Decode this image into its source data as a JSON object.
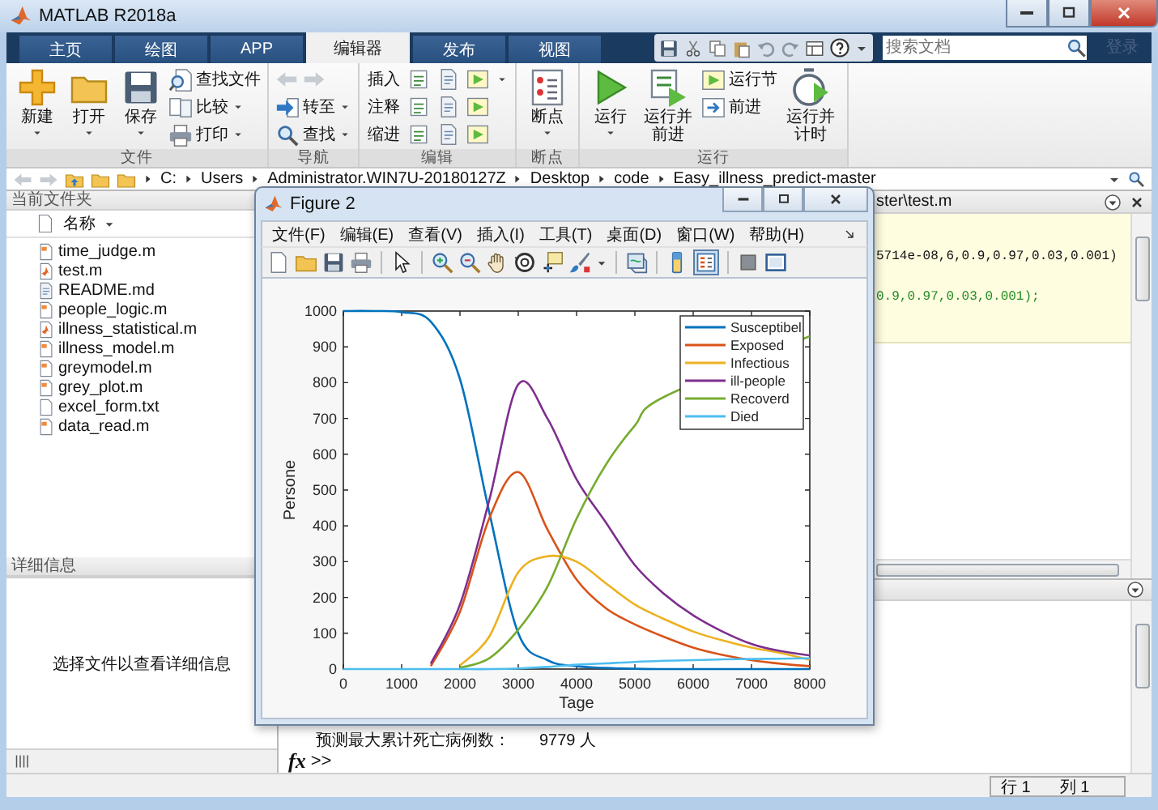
{
  "window": {
    "title": "MATLAB R2018a"
  },
  "tabs": [
    {
      "label": "主页",
      "selected": false
    },
    {
      "label": "绘图",
      "selected": false
    },
    {
      "label": "APP",
      "selected": false
    },
    {
      "label": "编辑器",
      "selected": true
    },
    {
      "label": "发布",
      "selected": false
    },
    {
      "label": "视图",
      "selected": false
    }
  ],
  "search": {
    "placeholder": "搜索文档"
  },
  "sign_in": "登录",
  "toolstrip": [
    {
      "label": "文件",
      "items": [
        {
          "kind": "large",
          "label": "新建",
          "caret": true
        },
        {
          "kind": "large",
          "label": "打开",
          "caret": true
        },
        {
          "kind": "large",
          "label": "保存",
          "caret": true
        },
        {
          "kind": "stack",
          "items": [
            {
              "kind": "button",
              "label": "查找文件",
              "caret": false
            },
            {
              "kind": "button",
              "label": "比较",
              "caret": true
            },
            {
              "kind": "button",
              "label": "打印",
              "caret": true
            }
          ]
        }
      ]
    },
    {
      "label": "导航",
      "items": [
        {
          "kind": "stack",
          "items": [
            {
              "kind": "arrows"
            },
            {
              "kind": "button",
              "label": "转至",
              "caret": true
            },
            {
              "kind": "button",
              "label": "查找",
              "caret": true
            }
          ]
        }
      ]
    },
    {
      "label": "编辑",
      "items": [
        {
          "kind": "icon-rows",
          "rows": [
            {
              "label": "插入",
              "caret": true
            },
            {
              "label": "注释",
              "caret": false
            },
            {
              "label": "缩进",
              "caret": false
            }
          ]
        }
      ]
    },
    {
      "label": "断点",
      "items": [
        {
          "kind": "large",
          "label": "断点",
          "caret": true
        }
      ]
    },
    {
      "label": "运行",
      "items": [
        {
          "kind": "large",
          "label": "运行",
          "caret": true
        },
        {
          "kind": "large",
          "label": "运行并前进",
          "caret": false
        },
        {
          "kind": "stack",
          "items": [
            {
              "kind": "button",
              "label": "运行节",
              "caret": false
            },
            {
              "kind": "button",
              "label": "前进",
              "caret": false
            }
          ]
        },
        {
          "kind": "large",
          "label": "运行并计时",
          "caret": false
        }
      ]
    }
  ],
  "address": {
    "path": [
      "C:",
      "Users",
      "Administrator.WIN7U-20180127Z",
      "Desktop",
      "code",
      "Easy_illness_predict-master"
    ]
  },
  "current_folder": {
    "title": "当前文件夹",
    "column": "名称",
    "files": [
      {
        "name": "time_judge.m",
        "kind": "function"
      },
      {
        "name": "test.m",
        "kind": "script"
      },
      {
        "name": "README.md",
        "kind": "document"
      },
      {
        "name": "people_logic.m",
        "kind": "function"
      },
      {
        "name": "illness_statistical.m",
        "kind": "script"
      },
      {
        "name": "illness_model.m",
        "kind": "function"
      },
      {
        "name": "greymodel.m",
        "kind": "function"
      },
      {
        "name": "grey_plot.m",
        "kind": "function"
      },
      {
        "name": "excel_form.txt",
        "kind": "text"
      },
      {
        "name": "data_read.m",
        "kind": "function"
      }
    ]
  },
  "details": {
    "title": "详细信息",
    "message": "选择文件以查看详细信息"
  },
  "editor": {
    "path": "ster\\test.m",
    "lines": [
      {
        "text": "5714e-08,6,0.9,0.97,0.03,0.001)",
        "kind": "code"
      },
      {
        "text": "0.9,0.97,0.03,0.001);",
        "kind": "comment"
      }
    ]
  },
  "command_window": {
    "lines": [
      {
        "label": "预测最大累计死亡病例数：",
        "value": "9779 人"
      }
    ],
    "fx": "fx",
    "prompt": ">>"
  },
  "status_bar": {
    "row": "行 1",
    "column": "列 1"
  },
  "figure": {
    "title": "Figure 2",
    "menu": [
      "文件(F)",
      "编辑(E)",
      "查看(V)",
      "插入(I)",
      "工具(T)",
      "桌面(D)",
      "窗口(W)",
      "帮助(H)"
    ],
    "chart_data": {
      "type": "line",
      "xlabel": "Tage",
      "ylabel": "Persone",
      "x": [
        0,
        500,
        1000,
        1500,
        2000,
        2500,
        3000,
        3500,
        4000,
        4500,
        5000,
        5500,
        6000,
        6500,
        7000,
        7500,
        8000
      ],
      "xlim": [
        0,
        8000
      ],
      "ylim": [
        0,
        1000
      ],
      "legend": true,
      "xticks": [
        0,
        1000,
        2000,
        3000,
        4000,
        5000,
        6000,
        7000,
        8000
      ],
      "yticks": [
        0,
        100,
        200,
        300,
        400,
        500,
        600,
        700,
        800,
        900,
        1000
      ],
      "series": [
        {
          "name": "Susceptibel",
          "color": "#0072bd",
          "values": [
            1000,
            1000,
            997,
            970,
            810,
            440,
            100,
            25,
            8,
            3,
            1,
            0,
            0,
            0,
            0,
            0,
            0
          ]
        },
        {
          "name": "Exposed",
          "color": "#d95319",
          "values": [
            null,
            null,
            null,
            8,
            160,
            420,
            550,
            390,
            250,
            170,
            125,
            90,
            60,
            40,
            25,
            15,
            8
          ]
        },
        {
          "name": "Infectious",
          "color": "#edb120",
          "values": [
            null,
            null,
            null,
            null,
            10,
            90,
            270,
            315,
            300,
            240,
            180,
            140,
            105,
            80,
            60,
            45,
            26
          ]
        },
        {
          "name": "ill-people",
          "color": "#7e2f8e",
          "values": [
            null,
            null,
            null,
            15,
            180,
            470,
            795,
            700,
            530,
            410,
            290,
            210,
            150,
            105,
            70,
            50,
            38
          ]
        },
        {
          "name": "Recoverd",
          "color": "#77ac30",
          "values": [
            null,
            null,
            null,
            null,
            3,
            30,
            110,
            230,
            420,
            570,
            680,
            760,
            null,
            null,
            null,
            null,
            930
          ]
        },
        {
          "name": "Died",
          "color": "#4dbeee",
          "values": [
            0,
            0,
            0,
            0,
            0,
            0,
            2,
            6,
            12,
            16,
            20,
            23,
            25,
            27,
            28,
            29,
            30
          ]
        }
      ]
    }
  }
}
